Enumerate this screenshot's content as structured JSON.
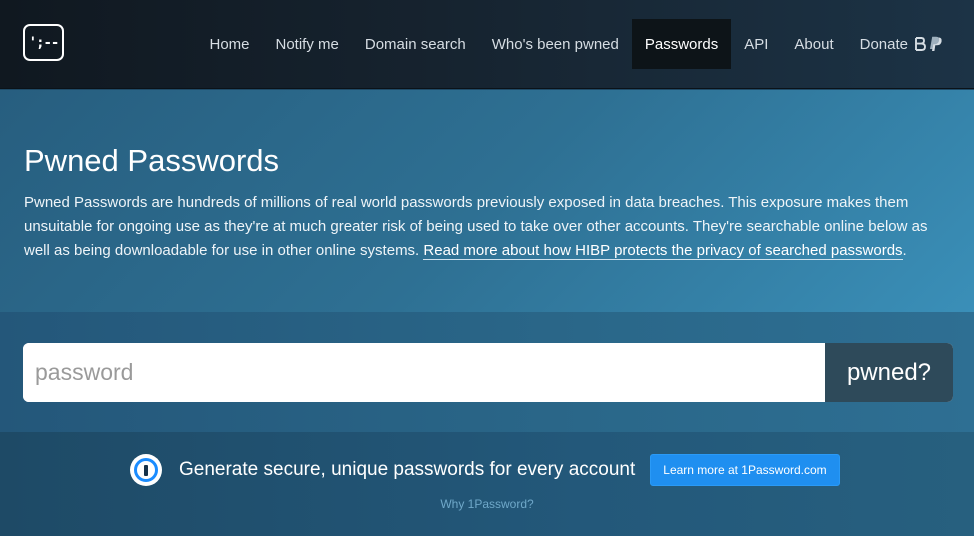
{
  "navbar": {
    "logo_text": "';--",
    "items": [
      {
        "label": "Home"
      },
      {
        "label": "Notify me"
      },
      {
        "label": "Domain search"
      },
      {
        "label": "Who's been pwned"
      },
      {
        "label": "Passwords",
        "active": true
      },
      {
        "label": "API"
      },
      {
        "label": "About"
      },
      {
        "label": "Donate"
      }
    ],
    "donate_icons": [
      "bitcoin-icon",
      "paypal-icon"
    ]
  },
  "hero": {
    "title": "Pwned Passwords",
    "description": "Pwned Passwords are hundreds of millions of real world passwords previously exposed in data breaches. This exposure makes them unsuitable for ongoing use as they're at much greater risk of being used to take over other accounts. They're searchable online below as well as being downloadable for use in other online systems. ",
    "privacy_link": "Read more about how HIBP protects the privacy of searched passwords",
    "trailing": "."
  },
  "search": {
    "placeholder": "password",
    "value": "",
    "button_label": "pwned?"
  },
  "promo": {
    "icon": "1password-icon",
    "text": "Generate secure, unique passwords for every account",
    "button_label": "Learn more at 1Password.com",
    "why_link": "Why 1Password?"
  },
  "colors": {
    "active_nav_bg": "#0d1418",
    "search_button_bg": "#2e4a5a",
    "promo_button_bg": "#1f8ff0",
    "why_link": "#6fa8c9"
  }
}
